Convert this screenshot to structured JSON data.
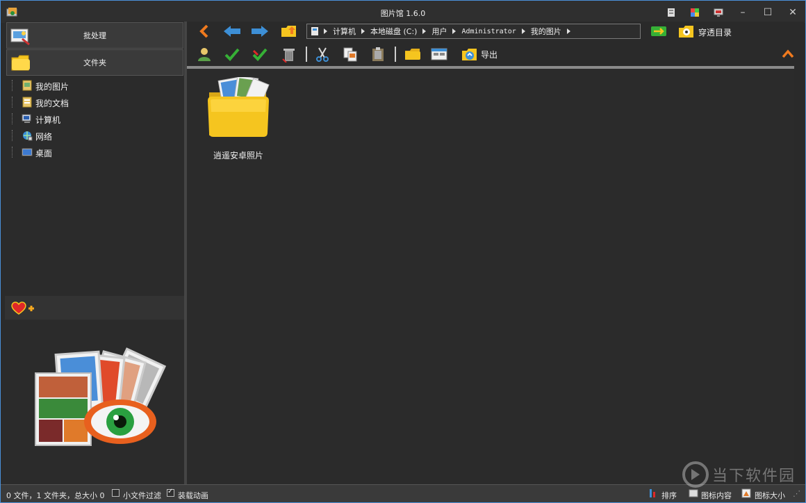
{
  "window": {
    "title": "图片馆 1.6.0",
    "controls": {
      "minimize": "–",
      "maximize": "☐",
      "close": "✕"
    }
  },
  "left_panel": {
    "batch_button": "批处理",
    "folder_button": "文件夹",
    "tree": [
      {
        "label": "我的图片",
        "icon": "pictures-folder-icon"
      },
      {
        "label": "我的文档",
        "icon": "documents-folder-icon"
      },
      {
        "label": "计算机",
        "icon": "computer-icon"
      },
      {
        "label": "网络",
        "icon": "network-icon"
      },
      {
        "label": "桌面",
        "icon": "desktop-icon"
      }
    ]
  },
  "address_bar": {
    "segments": [
      "计算机",
      "本地磁盘 (C:)",
      "用户",
      "Administrator",
      "我的图片"
    ]
  },
  "toolbar": {
    "through_dir_label": "穿透目录",
    "export_label": "导出"
  },
  "content": {
    "items": [
      {
        "label": "逍遥安卓照片",
        "type": "folder"
      }
    ]
  },
  "status_bar": {
    "summary": "0 文件，1 文件夹，总大小 0",
    "small_file_filter": "小文件过滤",
    "small_file_filter_checked": false,
    "load_animation": "装载动画",
    "load_animation_checked": true,
    "sort_label": "排序",
    "icon_content_label": "图标内容",
    "icon_size_label": "图标大小"
  },
  "watermark": {
    "text": "当下软件园"
  },
  "colors": {
    "accent_orange": "#f07a1e",
    "nav_blue": "#3d8fd6",
    "check_green": "#36b036",
    "folder_yellow": "#f5c51f"
  }
}
